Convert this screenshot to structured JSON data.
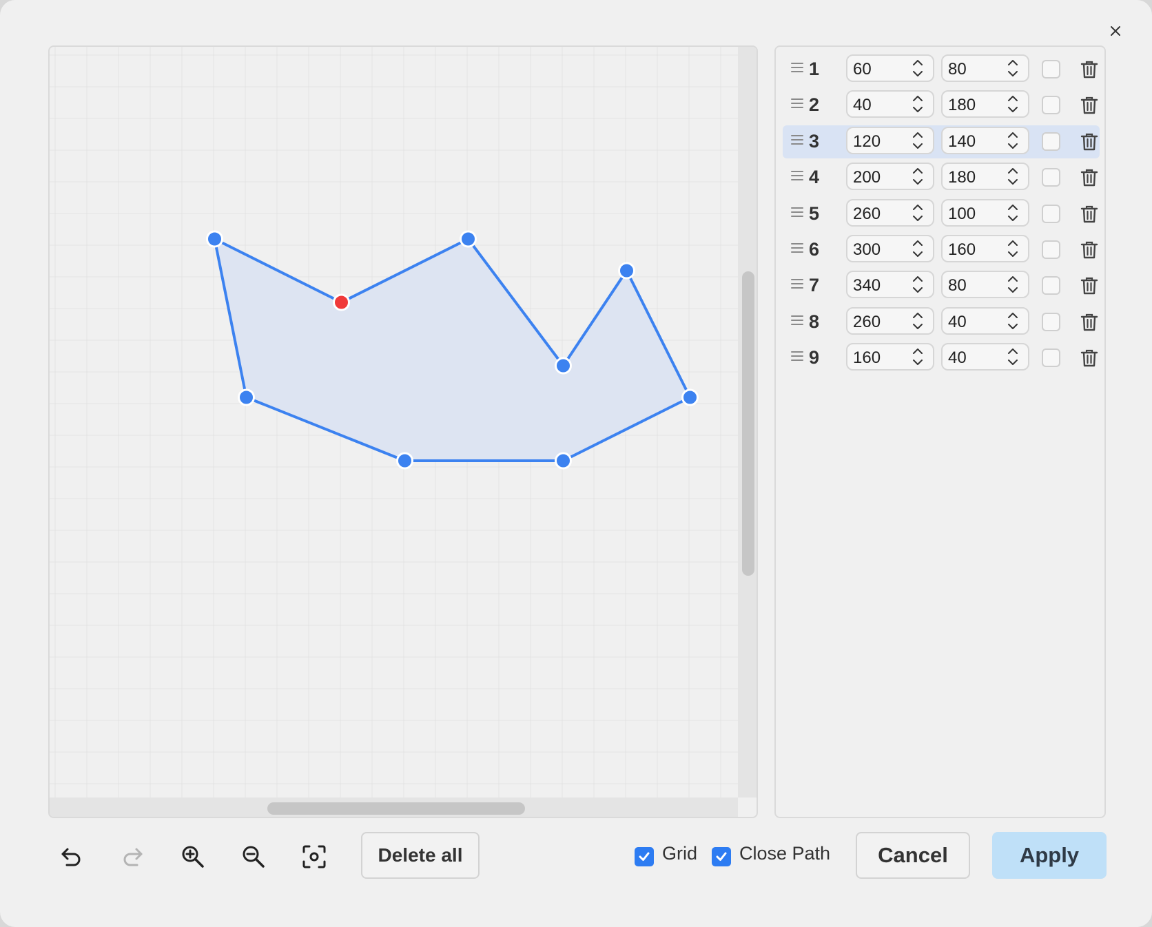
{
  "toolbar": {
    "delete_all_label": "Delete all",
    "grid_label": "Grid",
    "grid_checked": true,
    "close_path_label": "Close Path",
    "close_path_checked": true,
    "cancel_label": "Cancel",
    "apply_label": "Apply"
  },
  "colors": {
    "accent": "#3c82f0",
    "selected_point": "#f03a3a",
    "fill": "#dde4f2",
    "row_selected": "#d9e3f4",
    "apply_bg": "#bfe0f8"
  },
  "icons": {
    "close": "close-icon",
    "undo": "undo-icon",
    "redo": "redo-icon",
    "zoom_in": "zoom-in-icon",
    "zoom_out": "zoom-out-icon",
    "fit": "fit-view-icon",
    "drag": "drag-handle-icon",
    "delete": "trash-icon"
  },
  "selected_index": 3,
  "points": [
    {
      "index": "1",
      "x": "60",
      "y": "80",
      "checked": false
    },
    {
      "index": "2",
      "x": "40",
      "y": "180",
      "checked": false
    },
    {
      "index": "3",
      "x": "120",
      "y": "140",
      "checked": false
    },
    {
      "index": "4",
      "x": "200",
      "y": "180",
      "checked": false
    },
    {
      "index": "5",
      "x": "260",
      "y": "100",
      "checked": false
    },
    {
      "index": "6",
      "x": "300",
      "y": "160",
      "checked": false
    },
    {
      "index": "7",
      "x": "340",
      "y": "80",
      "checked": false
    },
    {
      "index": "8",
      "x": "260",
      "y": "40",
      "checked": false
    },
    {
      "index": "9",
      "x": "160",
      "y": "40",
      "checked": false
    }
  ]
}
